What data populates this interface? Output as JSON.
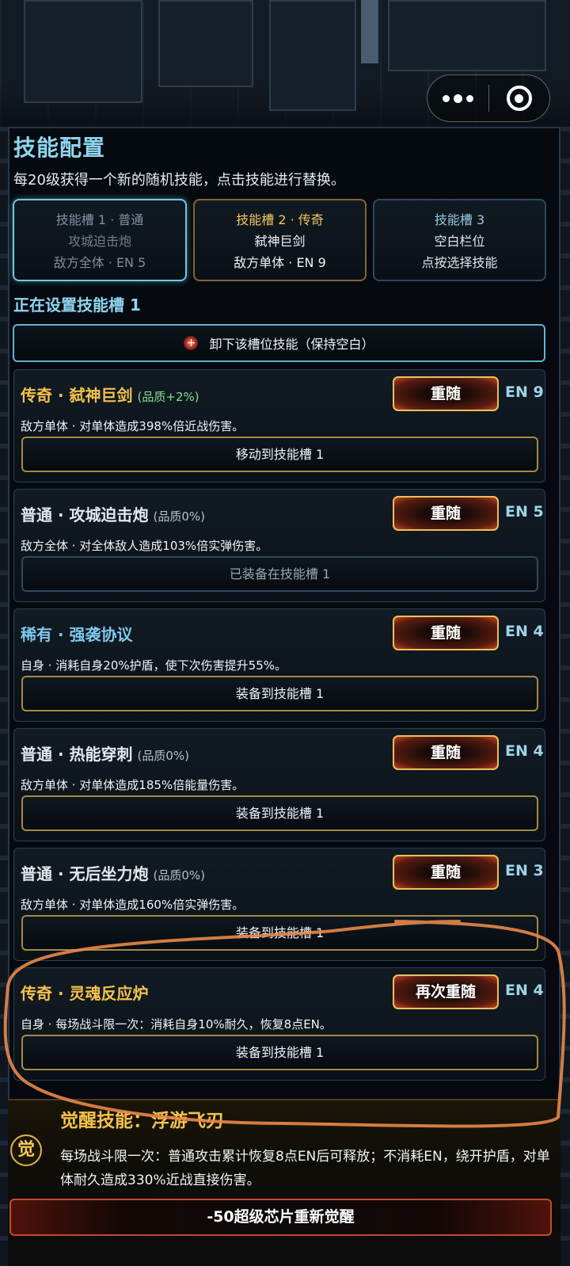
{
  "header": {
    "title": "技能配置",
    "subtitle": "每20级获得一个新的随机技能，点击技能进行替换。"
  },
  "capsule": {
    "more_icon": "more-dots-icon",
    "close_icon": "target-close-icon"
  },
  "slots": [
    {
      "line1": "技能槽 1 · 普通",
      "line2": "攻城迫击炮",
      "line3": "敌方全体 · EN 5"
    },
    {
      "line1": "技能槽 2 · 传奇",
      "line2": "弑神巨剑",
      "line3": "敌方单体 · EN 9"
    },
    {
      "line1": "技能槽 3",
      "line2": "空白栏位",
      "line3": "点按选择技能"
    }
  ],
  "current_label": "正在设置技能槽 1",
  "unequip_label": "卸下该槽位技能（保持空白）",
  "skills": [
    {
      "name": "传奇 · 弑神巨剑",
      "quality": "(品质+2%)",
      "desc": "敌方单体 · 对单体造成398%倍近战伤害。",
      "reroll": "重随",
      "en": "EN 9",
      "action": "移动到技能槽 1"
    },
    {
      "name": "普通 · 攻城迫击炮",
      "quality": "(品质0%)",
      "desc": "敌方全体 · 对全体敌人造成103%倍实弹伤害。",
      "reroll": "重随",
      "en": "EN 5",
      "action": "已装备在技能槽 1"
    },
    {
      "name": "稀有 · 强袭协议",
      "quality": "",
      "desc": "自身 · 消耗自身20%护盾，使下次伤害提升55%。",
      "reroll": "重随",
      "en": "EN 4",
      "action": "装备到技能槽 1"
    },
    {
      "name": "普通 · 热能穿刺",
      "quality": "(品质0%)",
      "desc": "敌方单体 · 对单体造成185%倍能量伤害。",
      "reroll": "重随",
      "en": "EN 4",
      "action": "装备到技能槽 1"
    },
    {
      "name": "普通 · 无后坐力炮",
      "quality": "(品质0%)",
      "desc": "敌方单体 · 对单体造成160%倍实弹伤害。",
      "reroll": "重随",
      "en": "EN 3",
      "action": "装备到技能槽 1"
    },
    {
      "name": "传奇 · 灵魂反应炉",
      "quality": "",
      "desc": "自身 · 每场战斗限一次：消耗自身10%耐久，恢复8点EN。",
      "reroll": "再次重随",
      "en": "EN 4",
      "action": "装备到技能槽 1"
    }
  ],
  "awaken": {
    "badge": "觉",
    "title": "觉醒技能：浮游飞刃",
    "desc": "每场战斗限一次：普通攻击累计恢复8点EN后可释放；不消耗EN，绕开护盾，对单体耐久造成330%近战直接伤害。",
    "button": "-50超级芯片重新觉醒"
  },
  "colors": {
    "accent_cyan": "#8fd6f0",
    "legendary": "#f3c24c",
    "rare": "#7ec8ec",
    "annotation": "#e8884a"
  }
}
